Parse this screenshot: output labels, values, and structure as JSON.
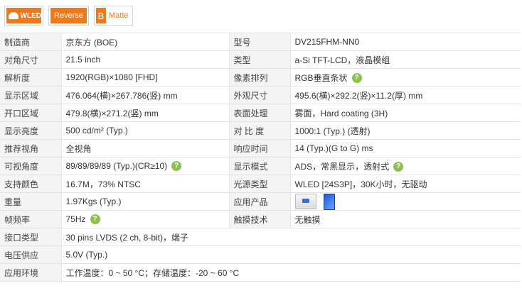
{
  "badges": {
    "wled": "WLED",
    "reverse": "Reverse",
    "matte_mark": "B",
    "matte": "Matte"
  },
  "rows": [
    {
      "k1": "制造商",
      "v1": "京东方 (BOE)",
      "k2": "型号",
      "v2": "DV215FHM-NN0"
    },
    {
      "k1": "对角尺寸",
      "v1": "21.5 inch",
      "k2": "类型",
      "v2": "a-Si TFT-LCD，液晶模组"
    },
    {
      "k1": "解析度",
      "v1": "1920(RGB)×1080  [FHD]",
      "k2": "像素排列",
      "v2": "RGB垂直条状"
    },
    {
      "k1": "显示区域",
      "v1": "476.064(横)×267.786(竖) mm",
      "k2": "外观尺寸",
      "v2": "495.6(横)×292.2(竖)×11.2(厚) mm"
    },
    {
      "k1": "开口区域",
      "v1": "479.8(横)×271.2(竖) mm",
      "k2": "表面处理",
      "v2": "雾面，Hard coating (3H)"
    },
    {
      "k1": "显示亮度",
      "v1": "500 cd/m² (Typ.)",
      "k2": "对 比 度",
      "v2": "1000:1 (Typ.) (透射)"
    },
    {
      "k1": "推荐视角",
      "v1": "全视角",
      "k2": "响应时间",
      "v2": "14 (Typ.)(G to G) ms"
    },
    {
      "k1": "可视角度",
      "v1": "89/89/89/89 (Typ.)(CR≥10)",
      "k2": "显示模式",
      "v2": "ADS，常黑显示，透射式"
    },
    {
      "k1": "支持颜色",
      "v1": "16.7M，73% NTSC",
      "k2": "光源类型",
      "v2": "WLED  [24S3P]，30K小时，无驱动"
    },
    {
      "k1": "重量",
      "v1": "1.97Kgs (Typ.)",
      "k2": "应用产品",
      "v2": ""
    },
    {
      "k1": "帧频率",
      "v1": "75Hz",
      "k2": "触摸技术",
      "v2": "无触摸"
    },
    {
      "k1": "接口类型",
      "v1": "30 pins   LVDS (2 ch, 8-bit)，端子"
    },
    {
      "k1": "电压供应",
      "v1": "5.0V (Typ.)"
    },
    {
      "k1": "应用环境",
      "v1": "工作温度：0 ~ 50 °C；存储温度：-20 ~ 60 °C"
    }
  ],
  "help_glyph": "?",
  "icons": {
    "help": "question-circle-icon",
    "app_monitor": "monitor-icon",
    "app_tablet": "tablet-icon"
  },
  "colors": {
    "badge": "#ef7a1a",
    "help": "#8cc152",
    "label_bg": "#f4f4f4",
    "border": "#e3e3e3"
  }
}
